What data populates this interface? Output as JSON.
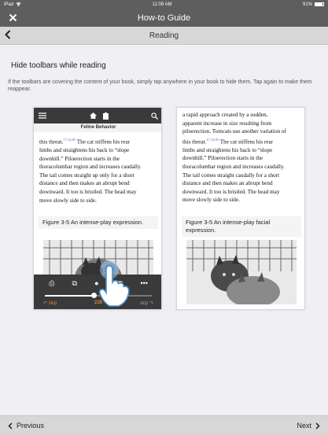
{
  "status_bar": {
    "device": "iPad",
    "wifi": "wifi-icon",
    "time": "11:09 AM",
    "battery": "91%"
  },
  "nav": {
    "title": "How-to Guide",
    "close_icon": "close-icon"
  },
  "subbar": {
    "title": "Reading",
    "back_icon": "chevron-left-icon"
  },
  "content": {
    "heading": "Hide toolbars while reading",
    "description": "If the toolbars are covering the content of your book, simply tap anywhere in your book to hide them. Tap again to make them reappear."
  },
  "left_device": {
    "book_title": "Feline Behavior",
    "text_lines": [
      "this threat.",
      "limbs and straightens his back to “slope",
      "downhill.” Piloerection starts in the",
      "thoracolumbar region and increases caudally.",
      "The tail comes straight up only for a short",
      "distance and then makes an abrupt bend",
      "downward. It too is bristled. The head may",
      "move slowly side to side."
    ],
    "ref1": "17,14,85",
    "ref1_tail": " The cat stiffens his rear",
    "figure_caption": "Figure 3-5 An intense-play expression.",
    "page_number": "238",
    "skip_left": "skip",
    "skip_right": "skip",
    "progress_fraction": 0.46
  },
  "right_device": {
    "text_lines": [
      "a rapid approach created by a sudden,",
      "apparent increase in size resulting from",
      "piloerection. Tomcats use another variation of",
      "this threat.",
      "limbs and straightens his back to “slope",
      "downhill.” Piloerection starts in the",
      "thoracolumbar region and increases caudally.",
      "The tail comes straight caudally for a short",
      "distance and then makes an abrupt bend",
      "downward. It too is bristled. The head may",
      "move slowly side to side."
    ],
    "ref1": "17,14,85",
    "ref1_tail": " The cat stiffens his rear",
    "figure_caption": "Figure 3-5 An intense-play facial expression."
  },
  "footer": {
    "previous": "Previous",
    "next": "Next"
  },
  "colors": {
    "bar_dark": "#5e5e5e",
    "bar_light": "#d7d7d7",
    "accent_orange": "#e0803a",
    "background": "#efeff4"
  }
}
